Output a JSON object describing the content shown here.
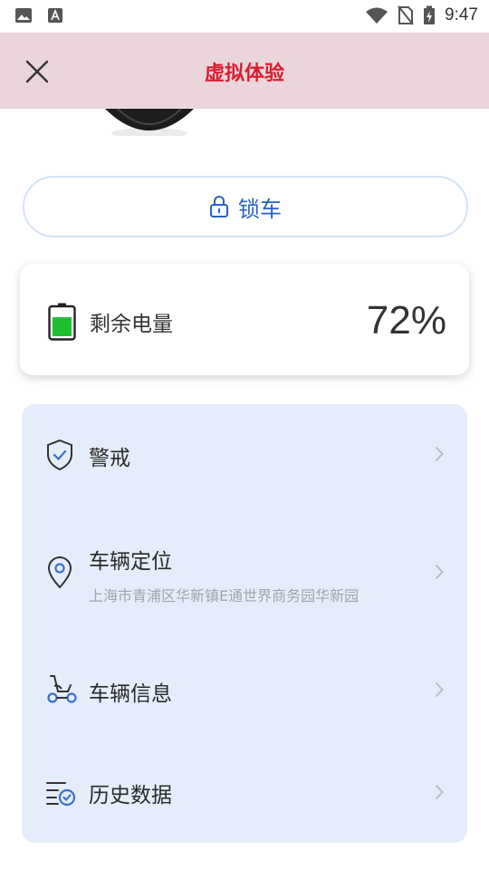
{
  "status_bar": {
    "time": "9:47"
  },
  "header": {
    "title": "虚拟体验"
  },
  "lock_button": {
    "label": "锁车"
  },
  "battery": {
    "label": "剩余电量",
    "value": "72%",
    "level": 0.72,
    "fill_color": "#1fbf33"
  },
  "menu": {
    "items": [
      {
        "title": "警戒",
        "subtitle": ""
      },
      {
        "title": "车辆定位",
        "subtitle": "上海市青浦区华新镇E通世界商务园华新园"
      },
      {
        "title": "车辆信息",
        "subtitle": ""
      },
      {
        "title": "历史数据",
        "subtitle": ""
      }
    ]
  },
  "colors": {
    "accent": "#2a62c6",
    "title": "#d81e31",
    "header_bg": "#ead6da",
    "menu_bg": "#e5edfb"
  },
  "icons": [
    "image-icon",
    "text-icon",
    "wifi-icon",
    "no-sim-icon",
    "battery-charging-icon",
    "close-icon",
    "lock-icon",
    "battery-icon",
    "shield-check-icon",
    "location-pin-icon",
    "scooter-icon",
    "history-list-icon",
    "chevron-right-icon"
  ]
}
